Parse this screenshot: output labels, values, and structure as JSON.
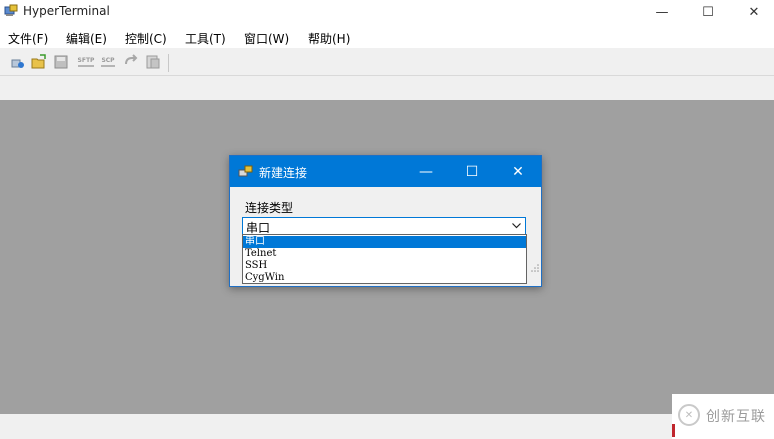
{
  "window": {
    "title": "HyperTerminal",
    "controls": {
      "minimize": "—",
      "maximize": "☐",
      "close": "✕"
    }
  },
  "menubar": {
    "items": [
      {
        "label": "文件(F)"
      },
      {
        "label": "编辑(E)"
      },
      {
        "label": "控制(C)"
      },
      {
        "label": "工具(T)"
      },
      {
        "label": "窗口(W)"
      },
      {
        "label": "帮助(H)"
      }
    ]
  },
  "toolbar": {
    "buttons": [
      {
        "icon": "new-connection-icon"
      },
      {
        "icon": "open-folder-icon"
      },
      {
        "icon": "save-disk-icon"
      },
      {
        "label": "SFTP",
        "icon": "sftp-icon"
      },
      {
        "label": "SCP",
        "icon": "scp-icon"
      },
      {
        "icon": "disconnect-icon"
      },
      {
        "icon": "properties-icon"
      }
    ]
  },
  "dialog": {
    "title": "新建连接",
    "controls": {
      "minimize": "—",
      "maximize": "☐",
      "close": "✕"
    },
    "connection_type_label": "连接类型",
    "selected_value": "串口",
    "options": [
      "串口",
      "Telnet",
      "SSH",
      "CygWin"
    ]
  },
  "watermark": {
    "text": "创新互联"
  },
  "colors": {
    "accent": "#0078d7",
    "workspace": "#a0a0a0"
  }
}
